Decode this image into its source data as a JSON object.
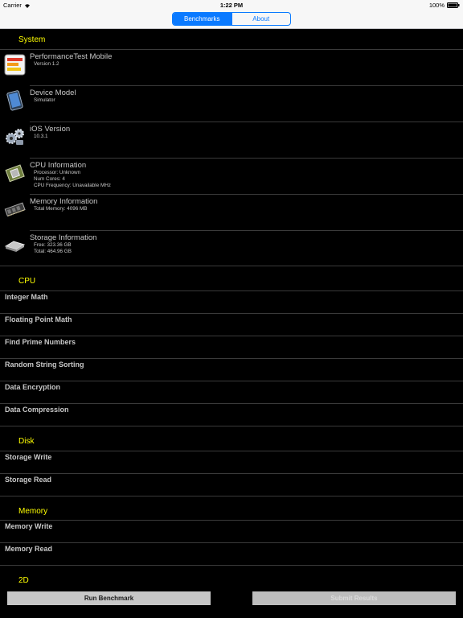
{
  "status_bar": {
    "carrier": "Carrier",
    "time": "1:22 PM",
    "battery": "100%"
  },
  "nav": {
    "tabs": [
      {
        "label": "Benchmarks",
        "active": true
      },
      {
        "label": "About",
        "active": false
      }
    ]
  },
  "sections": {
    "system": {
      "header": "System",
      "rows": [
        {
          "title": "PerformanceTest Mobile",
          "lines": [
            "Version 1.2"
          ],
          "icon": "performancetest-app-icon"
        },
        {
          "title": "Device Model",
          "lines": [
            "Simulator"
          ],
          "icon": "ipad-device-icon"
        },
        {
          "title": "iOS Version",
          "lines": [
            "10.3.1"
          ],
          "icon": "gears-icon"
        },
        {
          "title": "CPU Information",
          "lines": [
            "Processor: Unknown",
            "Num Cores: 4",
            "CPU Frequency: Unavailable MHz"
          ],
          "icon": "cpu-chip-icon"
        },
        {
          "title": "Memory Information",
          "lines": [
            "Total Memory: 4096 MB"
          ],
          "icon": "memory-module-icon"
        },
        {
          "title": "Storage Information",
          "lines": [
            "Free: 323.36 GB",
            "Total: 464.96 GB"
          ],
          "icon": "hard-drive-icon"
        }
      ]
    },
    "cpu": {
      "header": "CPU",
      "rows": [
        "Integer Math",
        "Floating Point Math",
        "Find Prime Numbers",
        "Random String Sorting",
        "Data Encryption",
        "Data Compression"
      ]
    },
    "disk": {
      "header": "Disk",
      "rows": [
        "Storage Write",
        "Storage Read"
      ]
    },
    "memory": {
      "header": "Memory",
      "rows": [
        "Memory Write",
        "Memory Read"
      ]
    },
    "twod": {
      "header": "2D"
    }
  },
  "buttons": {
    "run": "Run Benchmark",
    "submit": "Submit Results"
  },
  "colors": {
    "section_header": "#ffff00",
    "accent": "#0a7aff",
    "background": "#000000"
  }
}
